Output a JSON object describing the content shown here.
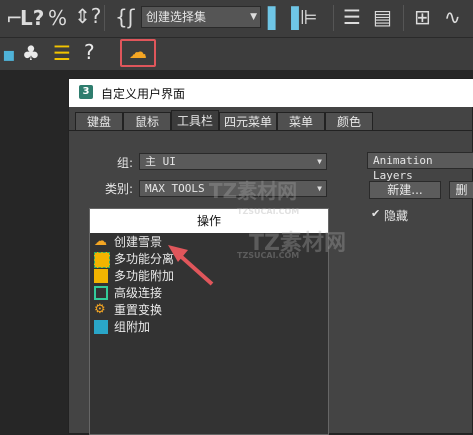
{
  "toolbar": {
    "selection_set": "创建选择集",
    "icons": [
      "link-icon",
      "percent-snap-icon",
      "spinner-snap-icon",
      "edit-named-sets-icon",
      "mirror-icon",
      "align-icon",
      "layer-explorer-icon",
      "ribbon-icon",
      "schematic-icon",
      "curve-editor-icon",
      "tree-icon",
      "list-icon",
      "help-icon",
      "snow-scene-icon"
    ]
  },
  "dialog": {
    "title_icon": "3",
    "title": "自定义用户界面",
    "tabs": [
      "键盘",
      "鼠标",
      "工具栏",
      "四元菜单",
      "菜单",
      "颜色"
    ],
    "active_tab": "工具栏",
    "group_label": "组:",
    "group_value": "主 UI",
    "category_label": "类别:",
    "category_value": "MAX TOOLS",
    "toolbar_combo": "Animation Layers",
    "new_button": "新建...",
    "delete_button": "删",
    "hide_checkbox": "隐藏",
    "list_header": "操作",
    "actions": [
      "创建雪景",
      "多功能分离",
      "多功能附加",
      "高级连接",
      "重置变换",
      "组附加"
    ]
  },
  "watermark": {
    "logo": "TZ素材网",
    "site": "TZSUCAI.COM"
  },
  "colors": {
    "highlight": "#e0565b",
    "bg": "#262626",
    "toolbar": "#3d3d3d"
  }
}
